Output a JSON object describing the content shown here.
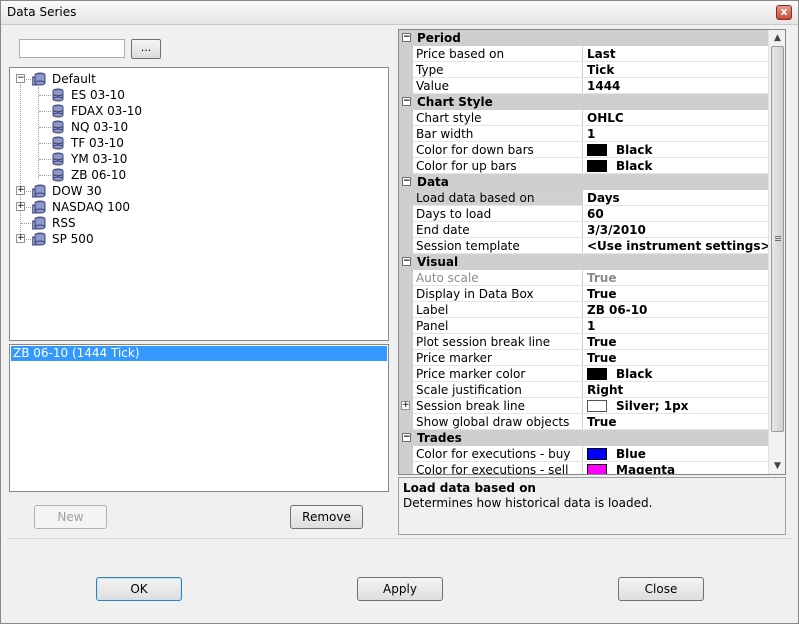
{
  "window": {
    "title": "Data Series",
    "close_glyph": "x"
  },
  "search": {
    "value": "",
    "browse_label": "..."
  },
  "tree": {
    "items": [
      {
        "label": "Default",
        "expanded": true,
        "toggle": "−"
      },
      {
        "label": "ES 03-10"
      },
      {
        "label": "FDAX 03-10"
      },
      {
        "label": "NQ 03-10"
      },
      {
        "label": "TF 03-10"
      },
      {
        "label": "YM 03-10"
      },
      {
        "label": "ZB 06-10"
      },
      {
        "label": "DOW 30",
        "toggle": "+"
      },
      {
        "label": "NASDAQ 100",
        "toggle": "+"
      },
      {
        "label": "RSS"
      },
      {
        "label": "SP 500",
        "toggle": "+"
      }
    ]
  },
  "series_list": {
    "items": [
      "ZB 06-10 (1444 Tick)"
    ]
  },
  "buttons": {
    "new": "New",
    "remove": "Remove",
    "ok": "OK",
    "apply": "Apply",
    "close": "Close"
  },
  "properties": {
    "categories": [
      {
        "name": "Period",
        "toggle": "−",
        "rows": [
          {
            "name": "Price based on",
            "value": "Last"
          },
          {
            "name": "Type",
            "value": "Tick"
          },
          {
            "name": "Value",
            "value": "1444"
          }
        ]
      },
      {
        "name": "Chart Style",
        "toggle": "−",
        "rows": [
          {
            "name": "Chart style",
            "value": "OHLC"
          },
          {
            "name": "Bar width",
            "value": "1"
          },
          {
            "name": "Color for down bars",
            "value": "Black",
            "swatch": "#000000"
          },
          {
            "name": "Color for up bars",
            "value": "Black",
            "swatch": "#000000"
          }
        ]
      },
      {
        "name": "Data",
        "toggle": "−",
        "rows": [
          {
            "name": "Load data based on",
            "value": "Days",
            "selected": true
          },
          {
            "name": "Days to load",
            "value": "60"
          },
          {
            "name": "End date",
            "value": "3/3/2010"
          },
          {
            "name": "Session template",
            "value": "<Use instrument settings>"
          }
        ]
      },
      {
        "name": "Visual",
        "toggle": "−",
        "rows": [
          {
            "name": "Auto scale",
            "value": "True",
            "disabled": true
          },
          {
            "name": "Display in Data Box",
            "value": "True"
          },
          {
            "name": "Label",
            "value": "ZB 06-10"
          },
          {
            "name": "Panel",
            "value": "1"
          },
          {
            "name": "Plot session break line",
            "value": "True"
          },
          {
            "name": "Price marker",
            "value": "True"
          },
          {
            "name": "Price marker color",
            "value": "Black",
            "swatch": "#000000"
          },
          {
            "name": "Scale justification",
            "value": "Right"
          },
          {
            "name": "Session break line",
            "value": "Silver; 1px",
            "swatch": "#ffffff",
            "expandable": true
          },
          {
            "name": "Show global draw objects",
            "value": "True"
          }
        ]
      },
      {
        "name": "Trades",
        "toggle": "−",
        "rows": [
          {
            "name": "Color for executions - buy",
            "value": "Blue",
            "swatch": "#0000ff"
          },
          {
            "name": "Color for executions - sell",
            "value": "Magenta",
            "swatch": "#ff00ff"
          }
        ]
      }
    ]
  },
  "help": {
    "title": "Load data based on",
    "description": "Determines how historical data is loaded."
  },
  "colors": {
    "selection": "#3399ff",
    "category_bg": "#cfcfcf"
  }
}
